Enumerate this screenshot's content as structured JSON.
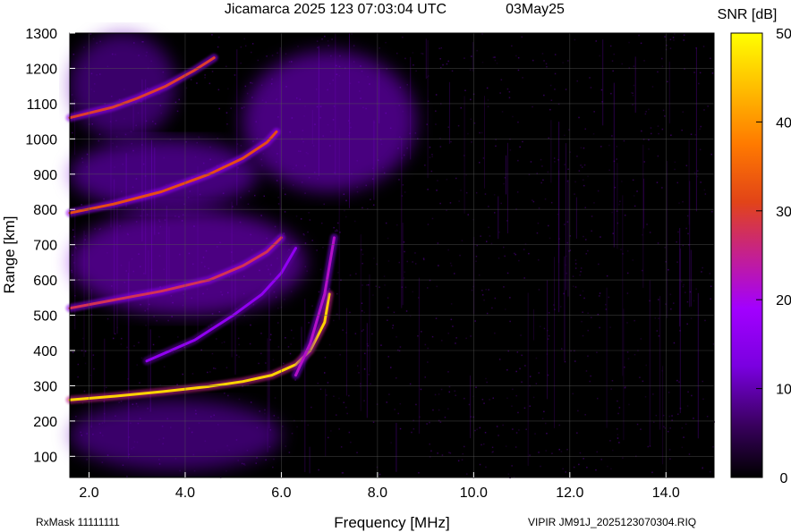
{
  "header": {
    "title": "Jicamarca 2025 123 07:03:04 UTC",
    "date": "03May25",
    "colorbar_label": "SNR [dB]"
  },
  "footer": {
    "left": "RxMask 11111111",
    "right": "VIPIR  JM91J_2025123070304.RIQ"
  },
  "colors": {
    "background": "#000000",
    "grid": "#555555",
    "colormap": [
      "#000000",
      "#5a007f",
      "#8a00ff",
      "#c02a80",
      "#e84a14",
      "#ff8c00",
      "#ffdf00",
      "#ffff20"
    ]
  },
  "chart_data": {
    "type": "heatmap",
    "title": "Jicamarca 2025 123 07:03:04 UTC",
    "xlabel": "Frequency [MHz]",
    "ylabel": "Range [km]",
    "xlim": [
      1.6,
      15.0
    ],
    "ylim": [
      40,
      1300
    ],
    "x_ticks": [
      "2.0",
      "4.0",
      "6.0",
      "8.0",
      "10.0",
      "12.0",
      "14.0"
    ],
    "x_tick_values": [
      2,
      4,
      6,
      8,
      10,
      12,
      14
    ],
    "y_ticks": [
      "100",
      "200",
      "300",
      "400",
      "500",
      "600",
      "700",
      "800",
      "900",
      "1000",
      "1100",
      "1200",
      "1300"
    ],
    "y_tick_values": [
      100,
      200,
      300,
      400,
      500,
      600,
      700,
      800,
      900,
      1000,
      1100,
      1200,
      1300
    ],
    "grid": true,
    "colorbar": {
      "label": "SNR [dB]",
      "range": [
        0,
        50
      ],
      "ticks": [
        "0",
        "10",
        "20",
        "30",
        "40",
        "50"
      ],
      "tick_values": [
        0,
        10,
        20,
        30,
        40,
        50
      ]
    },
    "traces": [
      {
        "x": [
          1.6,
          2.5,
          3.5,
          4.5,
          5.2,
          5.8,
          6.3,
          6.6,
          6.9,
          7.0
        ],
        "y": [
          260,
          270,
          283,
          298,
          312,
          330,
          360,
          400,
          480,
          560
        ],
        "snr": 46
      },
      {
        "x": [
          1.6,
          2.5,
          3.5,
          4.5,
          5.2,
          5.7,
          6.0
        ],
        "y": [
          520,
          543,
          568,
          600,
          640,
          680,
          720
        ],
        "snr": 28
      },
      {
        "x": [
          1.6,
          2.5,
          3.5,
          4.5,
          5.2,
          5.7,
          5.9
        ],
        "y": [
          790,
          815,
          850,
          900,
          945,
          990,
          1020
        ],
        "snr": 32
      },
      {
        "x": [
          1.6,
          2.5,
          3.0,
          3.6,
          4.2,
          4.6
        ],
        "y": [
          1060,
          1090,
          1115,
          1150,
          1195,
          1230
        ],
        "snr": 30
      },
      {
        "x": [
          3.2,
          4.2,
          5.0,
          5.6,
          6.0,
          6.3
        ],
        "y": [
          370,
          430,
          500,
          560,
          620,
          690
        ],
        "snr": 16
      },
      {
        "x": [
          6.3,
          6.6,
          6.9,
          7.1
        ],
        "y": [
          330,
          420,
          560,
          720
        ],
        "snr": 22
      }
    ],
    "diffuse_regions": [
      {
        "x": [
          1.6,
          6.5
        ],
        "y": [
          500,
          800
        ],
        "snr": 9
      },
      {
        "x": [
          1.6,
          5.5
        ],
        "y": [
          800,
          1000
        ],
        "snr": 7
      },
      {
        "x": [
          5.2,
          8.8
        ],
        "y": [
          850,
          1250
        ],
        "snr": 8
      },
      {
        "x": [
          1.6,
          3.8
        ],
        "y": [
          1000,
          1300
        ],
        "snr": 5
      },
      {
        "x": [
          1.6,
          6.0
        ],
        "y": [
          60,
          260
        ],
        "snr": 5
      }
    ]
  }
}
